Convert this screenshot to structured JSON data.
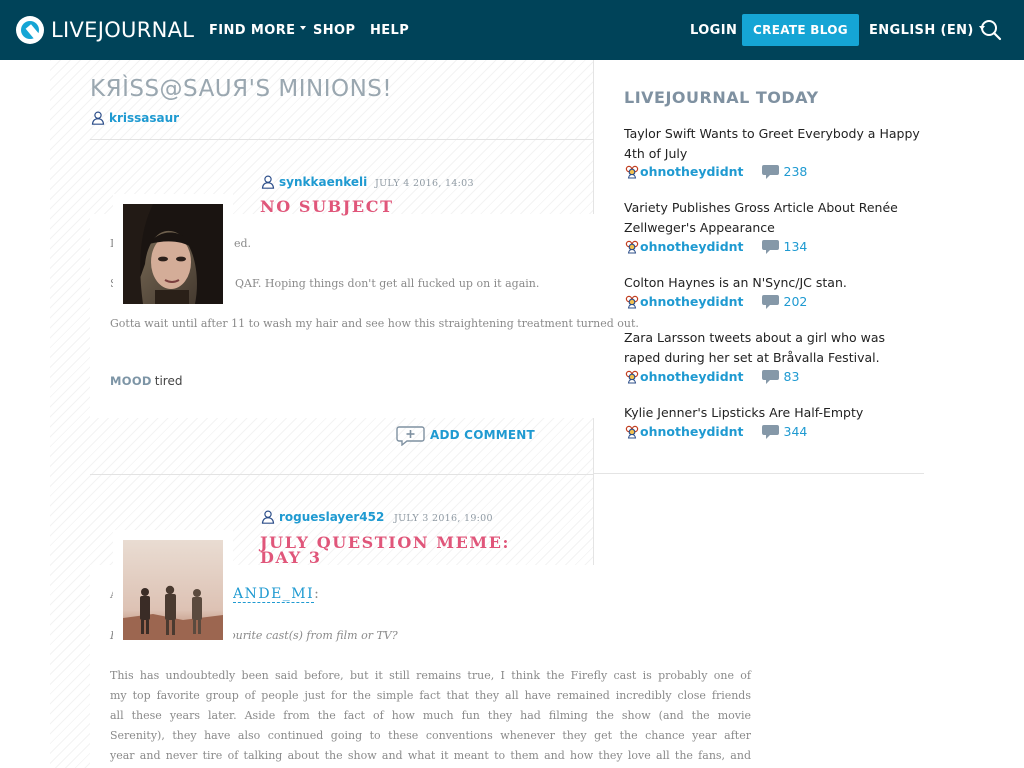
{
  "nav": {
    "logo_text": "LIVEJOURNAL",
    "find_more": "FIND MORE",
    "shop": "SHOP",
    "help": "HELP",
    "login": "LOGIN",
    "create_blog": "CREATE BLOG",
    "language": "ENGLISH (EN)",
    "colors": {
      "bar": "#004359",
      "accent": "#15a5d5"
    }
  },
  "journal": {
    "title": "KЯÌSS@SAUЯ'S MINIONS!",
    "owner": "krissasaur"
  },
  "entries": [
    {
      "author": "synkkaenkeli",
      "date": "JULY 4 2016, 14:03",
      "title": "NO SUBJECT",
      "lines": [
        "I",
        "ed.",
        "S",
        "QAF. Hoping things don't get all fucked up on it again.",
        "Gotta wait until after 11 to wash my hair and see how this straightening treatment turned out."
      ],
      "mood_label": "MOOD",
      "mood_value": "tired",
      "add_comment": "ADD COMMENT"
    },
    {
      "author": "rogueslayer452",
      "date": "JULY 3 2016, 19:00",
      "title": "JULY QUESTION MEME: DAY 3",
      "link_fragment": "ANDE_MI",
      "after_link": ":",
      "line_a": "A",
      "question_start": "F",
      "question_rest": "ourite cast(s) from film or TV?",
      "paragraph_lines": [
        "This has undoubtedly been said before, but it still remains true, I think the Firefly cast is probably one of",
        "my top favorite group of people just for the simple fact that they all have remained incredibly close friends",
        "all these years later. Aside from the fact of how much fun they had filming the show (and the movie",
        "Serenity), they have also continued going to these conventions whenever they get the chance year after",
        "year and never tire of talking about the show and what it meant to them and how they love all the fans, and"
      ]
    }
  ],
  "sidebar": {
    "title": "LIVEJOURNAL TODAY",
    "items": [
      {
        "title": "Taylor Swift Wants to Greet Everybody a Happy 4th of July",
        "community": "ohnotheydidnt",
        "comments": "238"
      },
      {
        "title": "Variety Publishes Gross Article About Renée Zellweger's Appearance",
        "community": "ohnotheydidnt",
        "comments": "134"
      },
      {
        "title": "Colton Haynes is an N'Sync/JC stan.",
        "community": "ohnotheydidnt",
        "comments": "202"
      },
      {
        "title": "Zara Larsson tweets about a girl who was raped during her set at Bråvalla Festival.",
        "community": "ohnotheydidnt",
        "comments": "83"
      },
      {
        "title": "Kylie Jenner's Lipsticks Are Half-Empty",
        "community": "ohnotheydidnt",
        "comments": "344"
      }
    ]
  }
}
